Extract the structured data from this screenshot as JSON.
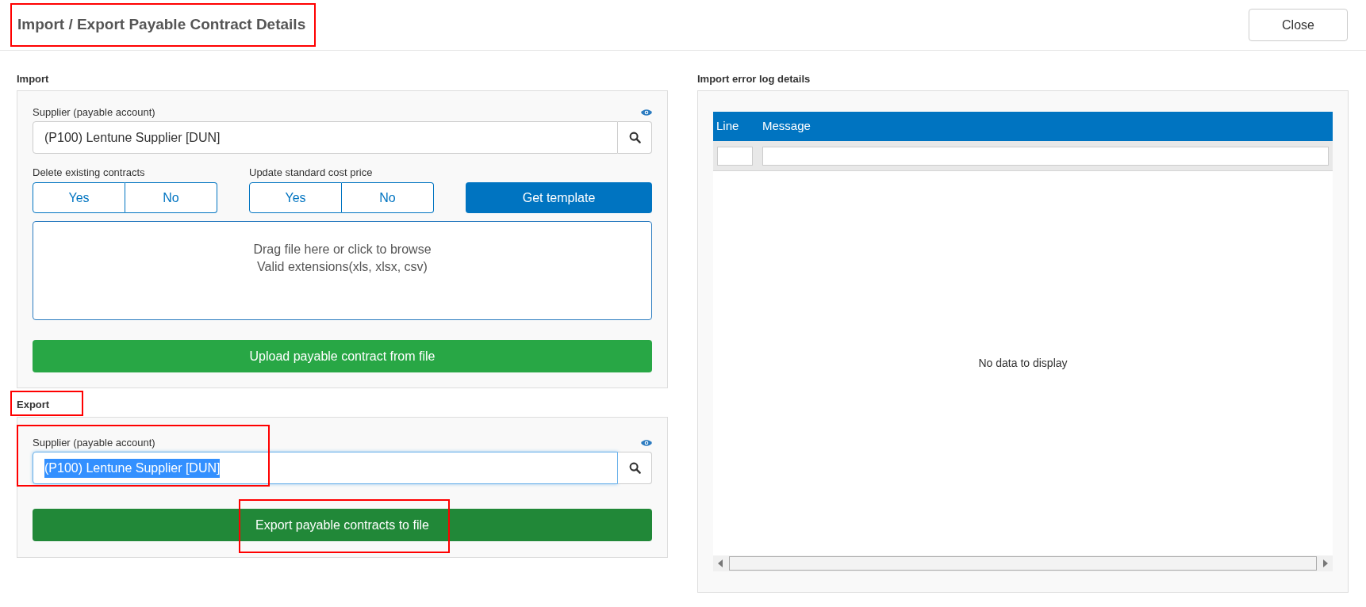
{
  "header": {
    "title": "Import / Export Payable Contract Details",
    "title_highlighted": true,
    "close_button": "Close"
  },
  "import": {
    "heading": "Import",
    "supplier": {
      "label": "Supplier (payable account)",
      "value": "(P100) Lentune Supplier [DUN]",
      "focused": false
    },
    "toggles": [
      {
        "label": "Delete existing contracts",
        "options": [
          {
            "label": "Yes",
            "selected": false
          },
          {
            "label": "No",
            "selected": false
          }
        ]
      },
      {
        "label": "Update standard cost price",
        "options": [
          {
            "label": "Yes",
            "selected": false
          },
          {
            "label": "No",
            "selected": false
          }
        ]
      }
    ],
    "template_button": "Get template",
    "dropzone": [
      "Drag file here or click to browse",
      "Valid extensions(xls, xlsx, csv)"
    ],
    "upload_button": "Upload payable contract from file"
  },
  "export": {
    "heading": "Export",
    "heading_highlighted": true,
    "supplier": {
      "label": "Supplier (payable account)",
      "value": "(P100) Lentune Supplier [DUN]",
      "focused": true,
      "highlighted": true
    },
    "export_button": "Export payable contracts to file",
    "export_button_highlighted": true
  },
  "error_log": {
    "heading": "Import error log details",
    "columns": [
      "Line",
      "Message"
    ],
    "empty_text": "No data to display"
  }
}
